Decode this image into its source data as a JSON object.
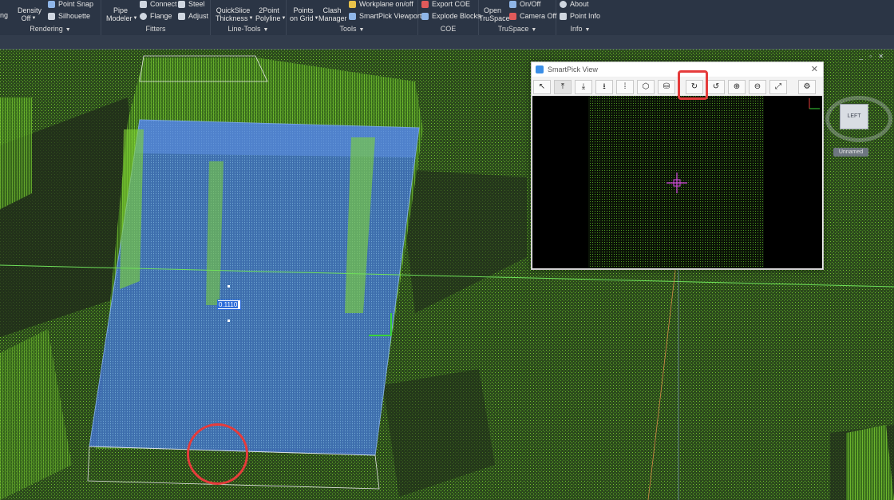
{
  "ribbon": {
    "groups": [
      {
        "label": "Rendering",
        "buttons": [
          {
            "label": "Density\nOff"
          },
          {
            "label": "Point Snap"
          },
          {
            "label": "Silhouette"
          },
          {
            "label": "ng"
          }
        ]
      },
      {
        "label": "Fitters",
        "buttons": [
          {
            "label": "Pipe\nModeler"
          },
          {
            "label": "Connect"
          },
          {
            "label": "Steel"
          },
          {
            "label": "Flange"
          },
          {
            "label": "Adjust"
          }
        ]
      },
      {
        "label": "Line-Tools",
        "buttons": [
          {
            "label": "QuickSlice\nThickness"
          },
          {
            "label": "2Point\nPolyline"
          }
        ]
      },
      {
        "label": "Tools",
        "buttons": [
          {
            "label": "Points\non Grid"
          },
          {
            "label": "Clash\nManager"
          },
          {
            "label": "Workplane on/off"
          },
          {
            "label": "SmartPick Viewport"
          }
        ]
      },
      {
        "label": "COE",
        "buttons": [
          {
            "label": "Export COE"
          },
          {
            "label": "Explode Blocks"
          }
        ]
      },
      {
        "label": "TruSpace",
        "buttons": [
          {
            "label": "Open\nTruSpace"
          },
          {
            "label": "On/Off"
          },
          {
            "label": "Camera Off"
          }
        ]
      },
      {
        "label": "Info",
        "buttons": [
          {
            "label": "About"
          },
          {
            "label": "Point Info"
          }
        ]
      }
    ]
  },
  "viewport": {
    "controls": "_ ▫ ✕",
    "viewcube": {
      "face": "LEFT",
      "named_view": "Unnamed"
    },
    "measurement_value": "0.1110"
  },
  "smartpick": {
    "title": "SmartPick View",
    "close": "✕",
    "toolbar": [
      {
        "name": "select-tool-button",
        "glyph": "↖"
      },
      {
        "name": "align-top-button",
        "glyph": "⤒"
      },
      {
        "name": "align-bottom-button",
        "glyph": "⤓"
      },
      {
        "name": "align-ground-button",
        "glyph": "⭳"
      },
      {
        "name": "slice-tool-button",
        "glyph": "⁞"
      },
      {
        "name": "cube-view-button",
        "glyph": "⬡"
      },
      {
        "name": "cylinder-button",
        "glyph": "⛁"
      },
      {
        "name": "rotate-cw-button",
        "glyph": "↻"
      },
      {
        "name": "rotate-ccw-button",
        "glyph": "↺"
      },
      {
        "name": "zoom-in-button",
        "glyph": "⊕"
      },
      {
        "name": "zoom-out-button",
        "glyph": "⊖"
      },
      {
        "name": "fit-view-button",
        "glyph": "⤢"
      },
      {
        "name": "settings-button",
        "glyph": "⚙"
      }
    ]
  },
  "colors": {
    "pointcloud": "#6fc62c",
    "selection": "#3f7fe0",
    "annotation": "#e53b3b",
    "ribbon": "#2b3545"
  }
}
